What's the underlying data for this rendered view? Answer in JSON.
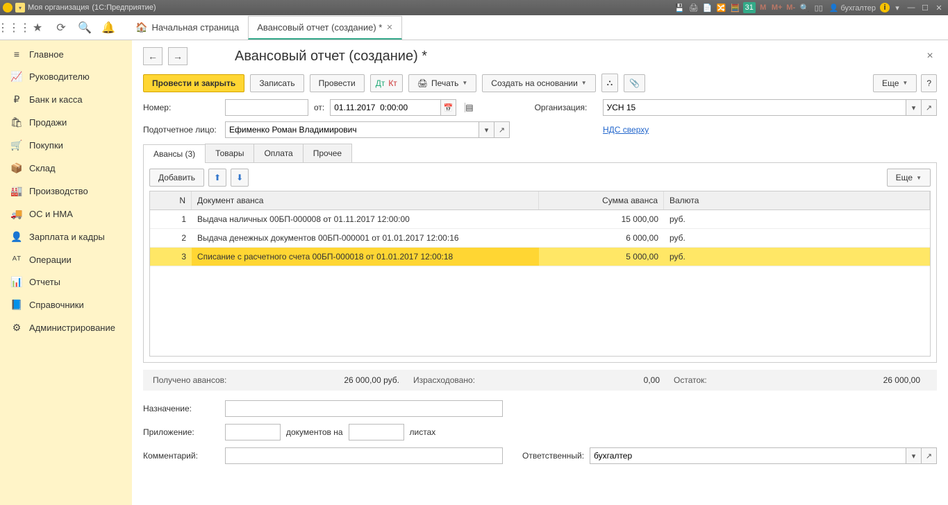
{
  "titlebar": {
    "org": "Моя организация",
    "app": "(1С:Предприятие)",
    "user": "бухгалтер"
  },
  "tabs": {
    "home": "Начальная страница",
    "active": "Авансовый отчет (создание) *"
  },
  "sidebar": [
    {
      "icon": "≡",
      "label": "Главное"
    },
    {
      "icon": "📈",
      "label": "Руководителю"
    },
    {
      "icon": "₽",
      "label": "Банк и касса"
    },
    {
      "icon": "🛍",
      "label": "Продажи"
    },
    {
      "icon": "🛒",
      "label": "Покупки"
    },
    {
      "icon": "📦",
      "label": "Склад"
    },
    {
      "icon": "🏭",
      "label": "Производство"
    },
    {
      "icon": "🚚",
      "label": "ОС и НМА"
    },
    {
      "icon": "👤",
      "label": "Зарплата и кадры"
    },
    {
      "icon": "ᴬᵀ",
      "label": "Операции"
    },
    {
      "icon": "📊",
      "label": "Отчеты"
    },
    {
      "icon": "📘",
      "label": "Справочники"
    },
    {
      "icon": "⚙",
      "label": "Администрирование"
    }
  ],
  "page": {
    "title": "Авансовый отчет (создание) *",
    "btn_primary": "Провести и закрыть",
    "btn_write": "Записать",
    "btn_post": "Провести",
    "btn_print": "Печать",
    "btn_createbase": "Создать на основании",
    "btn_more": "Еще",
    "lbl_number": "Номер:",
    "lbl_from": "от:",
    "date": "01.11.2017  0:00:00",
    "lbl_org": "Организация:",
    "org": "УСН 15",
    "lbl_person": "Подотчетное лицо:",
    "person": "Ефименко Роман Владимирович",
    "nds_link": "НДС сверху"
  },
  "doc_tabs": [
    "Авансы (3)",
    "Товары",
    "Оплата",
    "Прочее"
  ],
  "subtoolbar": {
    "add": "Добавить",
    "more": "Еще"
  },
  "grid": {
    "cols": [
      "N",
      "Документ аванса",
      "Сумма аванса",
      "Валюта"
    ],
    "rows": [
      {
        "n": "1",
        "doc": "Выдача наличных 00БП-000008 от 01.11.2017 12:00:00",
        "sum": "15 000,00",
        "cur": "руб."
      },
      {
        "n": "2",
        "doc": "Выдача денежных документов 00БП-000001 от 01.01.2017 12:00:16",
        "sum": "6 000,00",
        "cur": "руб."
      },
      {
        "n": "3",
        "doc": "Списание с расчетного счета 00БП-000018 от 01.01.2017 12:00:18",
        "sum": "5 000,00",
        "cur": "руб."
      }
    ]
  },
  "totals": {
    "received_lbl": "Получено авансов:",
    "received": "26 000,00",
    "received_cur": "руб.",
    "spent_lbl": "Израсходовано:",
    "spent": "0,00",
    "balance_lbl": "Остаток:",
    "balance": "26 000,00"
  },
  "footer": {
    "purpose": "Назначение:",
    "attach": "Приложение:",
    "attach_mid": "документов на",
    "attach_end": "листах",
    "comment": "Комментарий:",
    "responsible": "Ответственный:",
    "responsible_val": "бухгалтер"
  }
}
